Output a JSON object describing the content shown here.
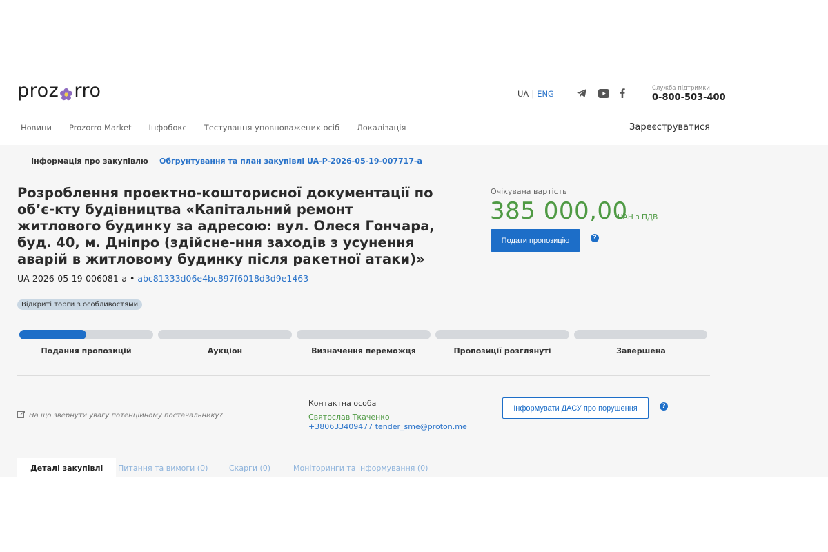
{
  "header": {
    "logo_text_left": "proz",
    "logo_text_right": "rro",
    "lang_ua": "UA",
    "lang_sep": "|",
    "lang_eng": "ENG",
    "social_icons": [
      "telegram-icon",
      "youtube-icon",
      "facebook-icon"
    ],
    "support_label": "Служба підтримки",
    "support_phone": "0-800-503-400"
  },
  "nav": {
    "items": [
      "Новини",
      "Prozorro Market",
      "Інфобокс",
      "Тестування уповноважених осіб",
      "Локалізація"
    ],
    "register": "Зареєструватися"
  },
  "top_tabs": {
    "info": "Інформація про закупівлю",
    "plan": "Обгрунтування та план закупівлі UA-P-2026-05-19-007717-a"
  },
  "tender": {
    "title": "Розроблення проектно-кошторисної документації по об’є-кту будівництва «Капітальний ремонт житлового будинку за адресою: вул. Олеся Гончара, буд. 40, м. Дніпро (здійсне-ння заходів з усунення аварій в житловому будинку після ракетної атаки)»",
    "id": "UA-2026-05-19-006081-a",
    "bullet": "•",
    "hash": "abc81333d06e4bc897f6018d3d9e1463",
    "procedure_badge": "Відкриті торги з особливостями"
  },
  "value": {
    "label": "Очікувана вартість",
    "amount": "385 000,00",
    "currency": "UAH з ПДВ",
    "offer_button": "Подати пропозицію",
    "help": "?"
  },
  "progress": {
    "stages": [
      "Подання пропозицій",
      "Аукціон",
      "Визначення переможця",
      "Пропозиції розглянуті",
      "Завершена"
    ],
    "active_stage_index": 0,
    "active_stage_fill": 0.5
  },
  "contact": {
    "hint": "На що звернути увагу потенційному постачальнику?",
    "label": "Контактна особа",
    "name": "Святослав Ткаченко",
    "info": "+380633409477 tender_sme@proton.me",
    "dasu_button": "Інформувати ДАСУ про порушення",
    "help": "?"
  },
  "bottom_tabs": {
    "details": "Деталі закупівлі",
    "questions": "Питання та вимоги (0)",
    "complaints": "Скарги (0)",
    "monitoring": "Моніторинги та інформування (0)"
  },
  "colors": {
    "accent": "#1d6ec8",
    "link": "#2a73c9",
    "amount_green": "#4f9a44",
    "logo_flower": "#8e6bbf"
  }
}
